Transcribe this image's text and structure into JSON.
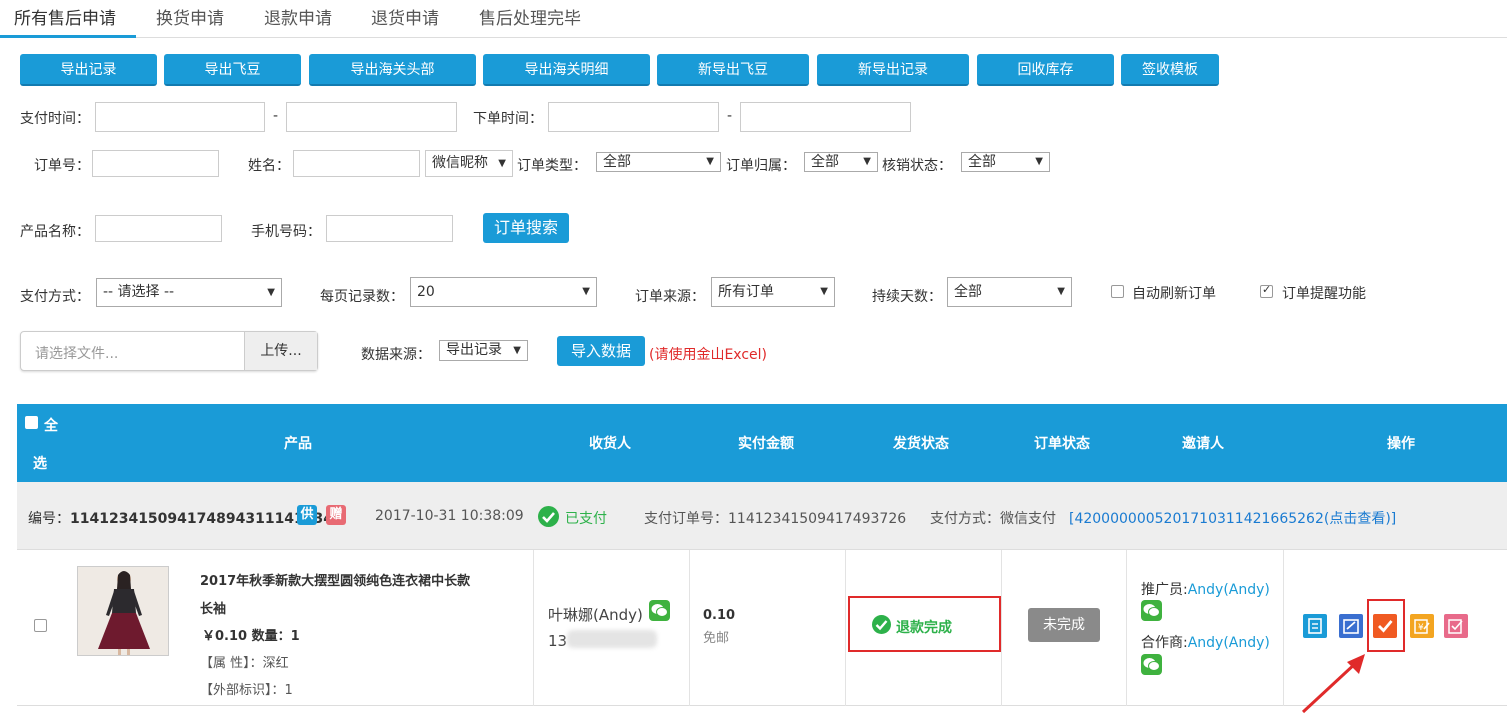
{
  "tabs": [
    "所有售后申请",
    "换货申请",
    "退款申请",
    "退货申请",
    "售后处理完毕"
  ],
  "toolbar": {
    "buttons": [
      "导出记录",
      "导出飞豆",
      "导出海关头部",
      "导出海关明细",
      "新导出飞豆",
      "新导出记录",
      "回收库存",
      "签收模板"
    ]
  },
  "filters": {
    "pay_time_label": "支付时间：",
    "dash": "-",
    "order_time_label": "下单时间：",
    "order_no_label": "订单号：",
    "name_label": "姓名：",
    "nickname_select": "微信昵称",
    "order_type_label": "订单类型：",
    "order_type_value": "全部",
    "order_owner_label": "订单归属：",
    "order_owner_value": "全部",
    "verify_label": "核销状态：",
    "verify_value": "全部",
    "product_label": "产品名称：",
    "phone_label": "手机号码：",
    "search_button": "订单搜索",
    "pay_method_label": "支付方式：",
    "pay_method_value": "-- 请选择 --",
    "page_size_label": "每页记录数：",
    "page_size_value": "20",
    "source_label": "订单来源：",
    "source_value": "所有订单",
    "days_label": "持续天数：",
    "days_value": "全部",
    "auto_refresh_label": "自动刷新订单",
    "auto_refresh_checked": false,
    "remind_label": "订单提醒功能",
    "remind_checked": true
  },
  "upload": {
    "placeholder": "请选择文件...",
    "button": "上传...",
    "data_source_label": "数据来源：",
    "data_source_value": "导出记录",
    "import_button": "导入数据",
    "hint": "(请使用金山Excel)"
  },
  "table": {
    "select_all_1": "全",
    "select_all_2": "选",
    "columns": [
      "产品",
      "收货人",
      "实付金额",
      "发货状态",
      "订单状态",
      "邀请人",
      "操作"
    ]
  },
  "order": {
    "number_label": "编号：",
    "number": "1141234150941748943111412​34",
    "badge_supply": "供",
    "badge_gift": "赠",
    "datetime": "2017-10-31 10:38:09",
    "pay_status": "已支付",
    "pay_order_label": "支付订单号：",
    "pay_order_no": "11412341509417493726",
    "pay_method_text": "支付方式：微信支付",
    "txn_link": "[4200000005201710311421665262(点击查看)]",
    "product_title_1": "2017年秋季新款大摆型圆领纯色连衣裙中长款",
    "product_title_2": "长袖",
    "price_line": "￥0.10 数量：1",
    "attr_line": "【属 性】：深红",
    "ext_line": "【外部标识】：1",
    "receiver_name": "叶琳娜(Andy)",
    "receiver_phone": "13",
    "amount": "0.10",
    "shipping": "免邮",
    "ship_status": "退款完成",
    "order_status": "未完成",
    "promoter_label": "推广员:",
    "promoter_name": "Andy(Andy)",
    "partner_label": "合作商:",
    "partner_name": "Andy(Andy)"
  },
  "colors": {
    "primary": "#1a9bd7",
    "success": "#2db14a",
    "danger": "#e02a2a",
    "link": "#1a7bd1"
  }
}
